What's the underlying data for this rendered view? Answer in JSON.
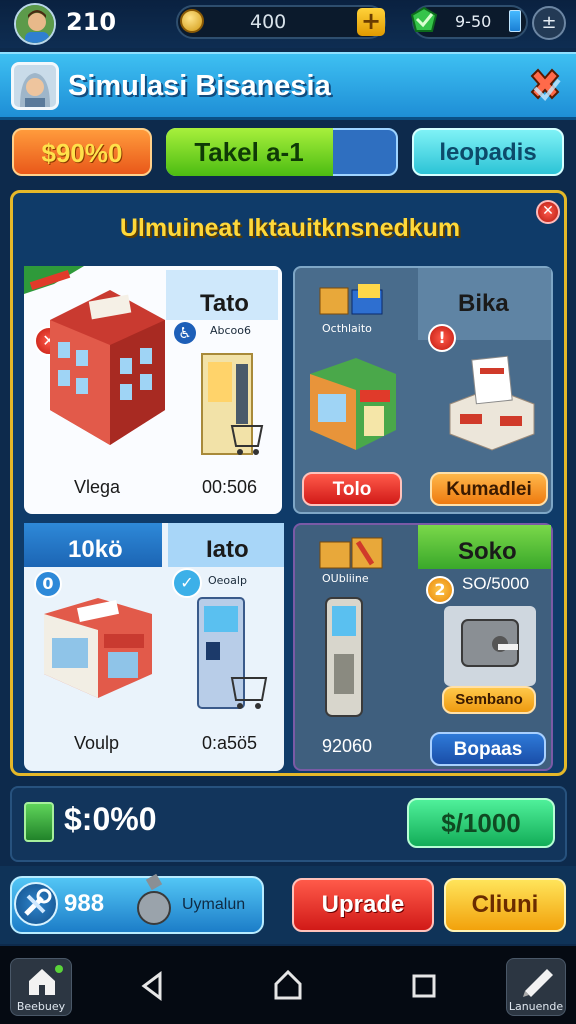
{
  "topbar": {
    "level": "210",
    "coins": "400",
    "coin_add_label": "+",
    "gems": "9-50",
    "settings_icon": "plus-minus-icon"
  },
  "header": {
    "title": "Simulasi Bisanesia",
    "close_icon": "close-x-icon"
  },
  "tabs": {
    "money": "$90%0",
    "takel": "Takel  a-1",
    "takel_progress": 0.72,
    "leopadis": "leopadis"
  },
  "panel": {
    "title": "Ulmuineat  Iktauitknsnedkum",
    "cards": [
      {
        "id": "card-1",
        "top_right_title": "Tato",
        "top_right_sub": "Abcoo6",
        "bottom_left": "Vlega",
        "bottom_right": "00:506",
        "badge_symbol": "✕"
      },
      {
        "id": "card-2",
        "top_left_sub": "Octhlaito",
        "top_right_title": "Bika",
        "badge_symbol": "!",
        "button_left": "Tolo",
        "button_right": "Kumadlei"
      },
      {
        "id": "card-3",
        "top_left_title": "10kö",
        "top_right_title": "Iato",
        "top_right_sub": "Oeoalp",
        "bottom_left": "Voulp",
        "bottom_right": "0:a5ö5",
        "badge_symbol": "0"
      },
      {
        "id": "card-4",
        "top_left_sub": "OUbliine",
        "top_right_title": "Soko",
        "top_right_sub": "SO/5000",
        "badge_symbol": "2",
        "bottom_left": "92060",
        "button_right_top": "Sembano",
        "button_right": "Bopaas"
      }
    ]
  },
  "balance": {
    "value": "$:0%0",
    "button": "$/1000"
  },
  "actions": {
    "tool_count": "988",
    "tool_label": "Uymalun",
    "upgrade": "Uprade",
    "claim": "Cliuni"
  },
  "sysnav": {
    "home_label": "Beebuey",
    "edit_label": "Lanuende"
  },
  "colors": {
    "accent_blue": "#1e8ed6",
    "panel_border": "#e5b829",
    "red_button": "#d11a18",
    "yellow_button": "#f2a20c",
    "green_button": "#13ad58"
  }
}
